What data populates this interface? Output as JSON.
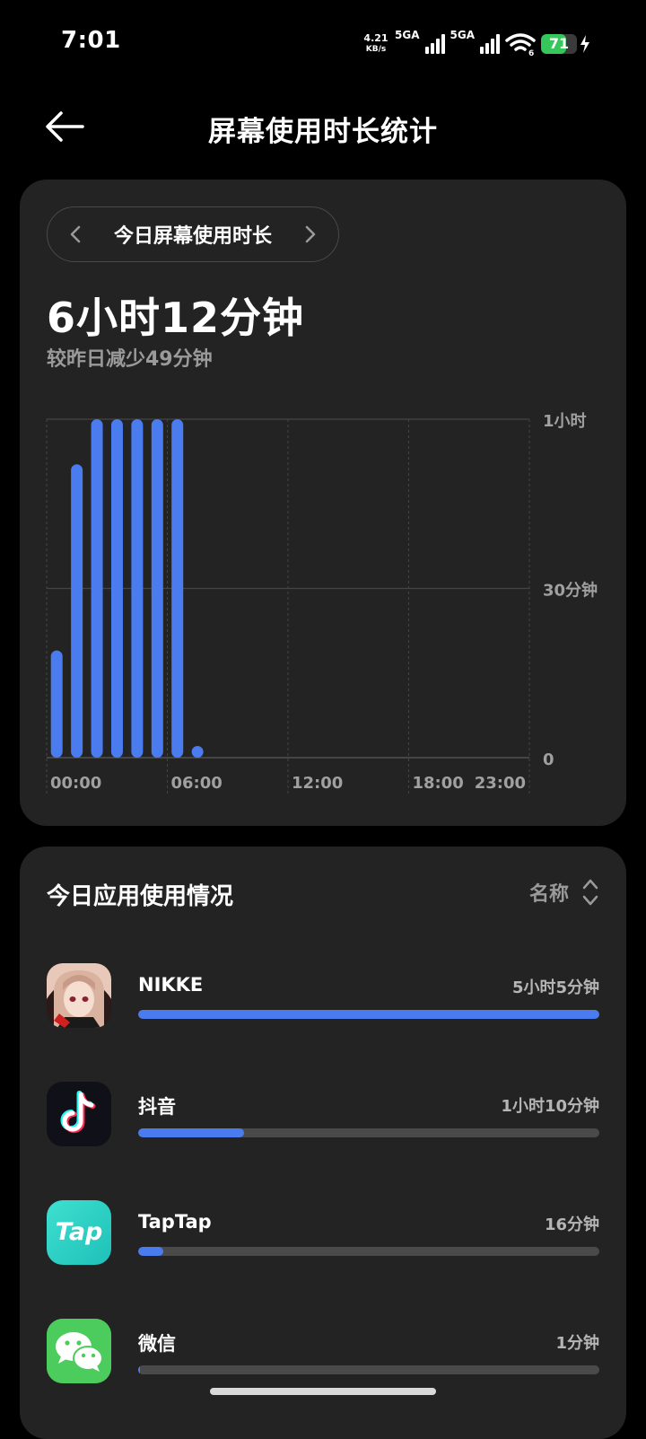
{
  "status_bar": {
    "time": "7:01",
    "net_speed": "4.21",
    "net_unit": "KB/s",
    "sim1": "5GA",
    "sim2": "5GA",
    "wifi_badge": "6",
    "battery": "71",
    "battery_level": 0.71,
    "accent_green": "#35c759"
  },
  "header": {
    "title": "屏幕使用时长统计",
    "back_icon": "arrow-left-icon"
  },
  "summary": {
    "range_label": "今日屏幕使用时长",
    "total": "6小时12分钟",
    "compare": "较昨日减少49分钟"
  },
  "chart_data": {
    "type": "bar",
    "unit": "minutes",
    "ylim": [
      0,
      60
    ],
    "y_ticks": [
      {
        "value": 60,
        "label": "1小时"
      },
      {
        "value": 30,
        "label": "30分钟"
      },
      {
        "value": 0,
        "label": "0"
      }
    ],
    "x_tick_labels": [
      {
        "hour": 0,
        "label": "00:00"
      },
      {
        "hour": 6,
        "label": "06:00"
      },
      {
        "hour": 12,
        "label": "12:00"
      },
      {
        "hour": 18,
        "label": "18:00"
      },
      {
        "hour": 23,
        "label": "23:00"
      }
    ],
    "grid": true,
    "bar_color": "#4a7cf0",
    "hours": [
      "00:00",
      "01:00",
      "02:00",
      "03:00",
      "04:00",
      "05:00",
      "06:00",
      "07:00",
      "08:00",
      "09:00",
      "10:00",
      "11:00",
      "12:00",
      "13:00",
      "14:00",
      "15:00",
      "16:00",
      "17:00",
      "18:00",
      "19:00",
      "20:00",
      "21:00",
      "22:00",
      "23:00"
    ],
    "values": [
      19,
      52,
      60,
      60,
      60,
      60,
      60,
      1,
      0,
      0,
      0,
      0,
      0,
      0,
      0,
      0,
      0,
      0,
      0,
      0,
      0,
      0,
      0,
      0
    ]
  },
  "apps_section": {
    "title": "今日应用使用情况",
    "sort_label": "名称",
    "accent": "#4a7cf0",
    "items": [
      {
        "name": "NIKKE",
        "time": "5小时5分钟",
        "fraction": 1.0,
        "icon": "nikke-app-icon"
      },
      {
        "name": "抖音",
        "time": "1小时10分钟",
        "fraction": 0.23,
        "icon": "douyin-app-icon"
      },
      {
        "name": "TapTap",
        "time": "16分钟",
        "fraction": 0.055,
        "icon": "taptap-app-icon",
        "icon_text": "Tap"
      },
      {
        "name": "微信",
        "time": "1分钟",
        "fraction": 0.004,
        "icon": "wechat-app-icon"
      }
    ]
  }
}
